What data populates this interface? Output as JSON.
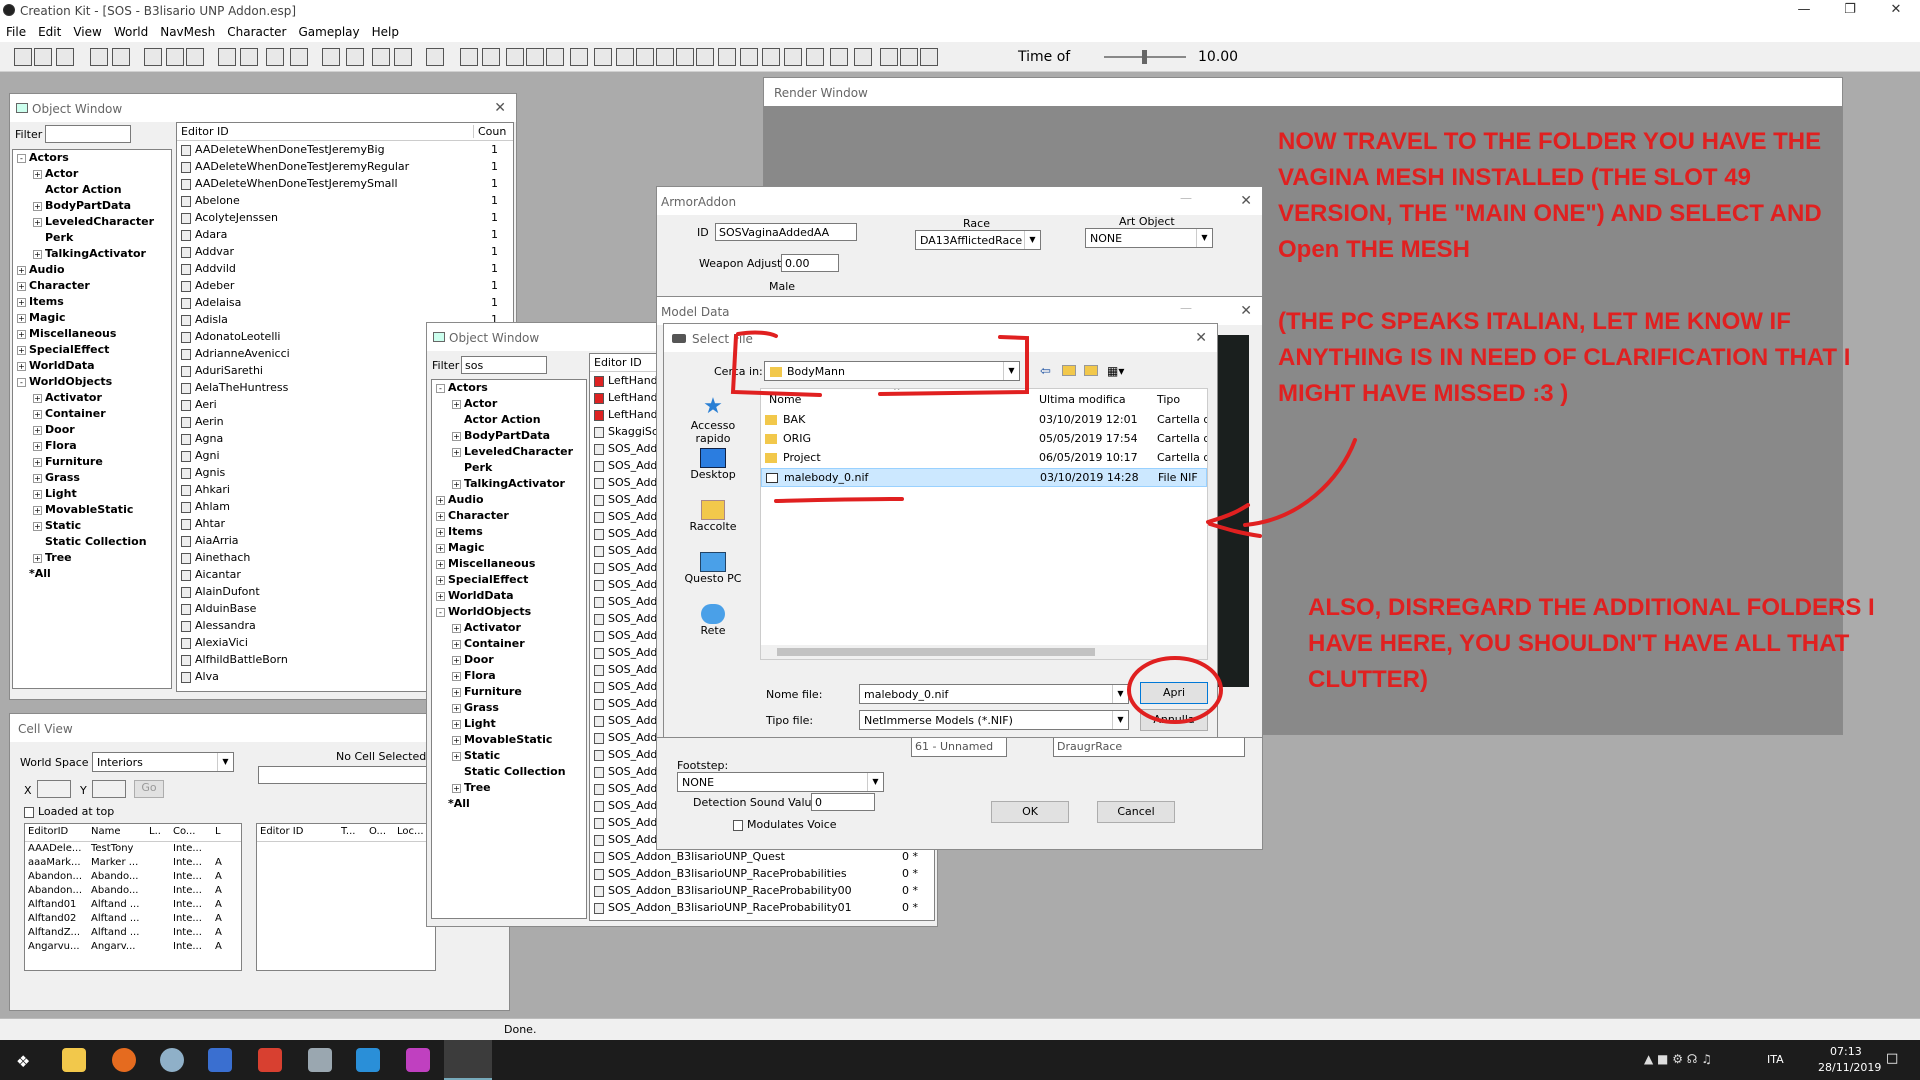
{
  "app": {
    "title": "Creation Kit - [SOS - B3lisario UNP Addon.esp]",
    "menu": [
      "File",
      "Edit",
      "View",
      "World",
      "NavMesh",
      "Character",
      "Gameplay",
      "Help"
    ],
    "time_label": "Time of",
    "time_value": "10.00",
    "status": "Done."
  },
  "object_window_1": {
    "title": "Object Window",
    "filter_label": "Filter",
    "filter_value": "",
    "columns": [
      "Editor ID",
      "Coun"
    ],
    "tree": [
      {
        "label": "Actors",
        "exp": "-",
        "indent": 0
      },
      {
        "label": "Actor",
        "exp": "+",
        "indent": 1
      },
      {
        "label": "Actor Action",
        "exp": "",
        "indent": 1
      },
      {
        "label": "BodyPartData",
        "exp": "+",
        "indent": 1
      },
      {
        "label": "LeveledCharacter",
        "exp": "+",
        "indent": 1
      },
      {
        "label": "Perk",
        "exp": "",
        "indent": 1
      },
      {
        "label": "TalkingActivator",
        "exp": "+",
        "indent": 1
      },
      {
        "label": "Audio",
        "exp": "+",
        "indent": 0
      },
      {
        "label": "Character",
        "exp": "+",
        "indent": 0
      },
      {
        "label": "Items",
        "exp": "+",
        "indent": 0
      },
      {
        "label": "Magic",
        "exp": "+",
        "indent": 0
      },
      {
        "label": "Miscellaneous",
        "exp": "+",
        "indent": 0
      },
      {
        "label": "SpecialEffect",
        "exp": "+",
        "indent": 0
      },
      {
        "label": "WorldData",
        "exp": "+",
        "indent": 0
      },
      {
        "label": "WorldObjects",
        "exp": "-",
        "indent": 0
      },
      {
        "label": "Activator",
        "exp": "+",
        "indent": 1
      },
      {
        "label": "Container",
        "exp": "+",
        "indent": 1
      },
      {
        "label": "Door",
        "exp": "+",
        "indent": 1
      },
      {
        "label": "Flora",
        "exp": "+",
        "indent": 1
      },
      {
        "label": "Furniture",
        "exp": "+",
        "indent": 1
      },
      {
        "label": "Grass",
        "exp": "+",
        "indent": 1
      },
      {
        "label": "Light",
        "exp": "+",
        "indent": 1
      },
      {
        "label": "MovableStatic",
        "exp": "+",
        "indent": 1
      },
      {
        "label": "Static",
        "exp": "+",
        "indent": 1
      },
      {
        "label": "Static Collection",
        "exp": "",
        "indent": 1
      },
      {
        "label": "Tree",
        "exp": "+",
        "indent": 1
      },
      {
        "label": "*All",
        "exp": "",
        "indent": 0
      }
    ],
    "rows": [
      [
        "AADeleteWhenDoneTestJeremyBig",
        "1"
      ],
      [
        "AADeleteWhenDoneTestJeremyRegular",
        "1"
      ],
      [
        "AADeleteWhenDoneTestJeremySmall",
        "1"
      ],
      [
        "Abelone",
        "1"
      ],
      [
        "AcolyteJenssen",
        "1"
      ],
      [
        "Adara",
        "1"
      ],
      [
        "Addvar",
        "1"
      ],
      [
        "Addvild",
        "1"
      ],
      [
        "Adeber",
        "1"
      ],
      [
        "Adelaisa",
        "1"
      ],
      [
        "Adisla",
        "1"
      ],
      [
        "AdonatoLeotelli",
        "1"
      ],
      [
        "AdrianneAvenicci",
        "1"
      ],
      [
        "AduriSarethi",
        "1"
      ],
      [
        "AelaTheHuntress",
        "1"
      ],
      [
        "Aeri",
        "1"
      ],
      [
        "Aerin",
        "1"
      ],
      [
        "Agna",
        "1"
      ],
      [
        "Agni",
        "1"
      ],
      [
        "Agnis",
        "1"
      ],
      [
        "Ahkari",
        "1"
      ],
      [
        "Ahlam",
        "1"
      ],
      [
        "Ahtar",
        "1"
      ],
      [
        "AiaArria",
        "1"
      ],
      [
        "Ainethach",
        "1"
      ],
      [
        "Aicantar",
        "1"
      ],
      [
        "AlainDufont",
        "1"
      ],
      [
        "AlduinBase",
        "1"
      ],
      [
        "Alessandra",
        "1"
      ],
      [
        "AlexiaVici",
        "1"
      ],
      [
        "AlfhildBattleBorn",
        "1"
      ],
      [
        "Alva",
        "1"
      ]
    ]
  },
  "object_window_2": {
    "title": "Object Window",
    "filter_label": "Filter",
    "filter_value": "sos",
    "column": "Editor ID",
    "tree": [
      {
        "label": "Actors",
        "exp": "-",
        "indent": 0
      },
      {
        "label": "Actor",
        "exp": "+",
        "indent": 1
      },
      {
        "label": "Actor Action",
        "exp": "",
        "indent": 1
      },
      {
        "label": "BodyPartData",
        "exp": "+",
        "indent": 1
      },
      {
        "label": "LeveledCharacter",
        "exp": "+",
        "indent": 1
      },
      {
        "label": "Perk",
        "exp": "",
        "indent": 1
      },
      {
        "label": "TalkingActivator",
        "exp": "+",
        "indent": 1
      },
      {
        "label": "Audio",
        "exp": "+",
        "indent": 0
      },
      {
        "label": "Character",
        "exp": "+",
        "indent": 0
      },
      {
        "label": "Items",
        "exp": "+",
        "indent": 0
      },
      {
        "label": "Magic",
        "exp": "+",
        "indent": 0
      },
      {
        "label": "Miscellaneous",
        "exp": "+",
        "indent": 0
      },
      {
        "label": "SpecialEffect",
        "exp": "+",
        "indent": 0
      },
      {
        "label": "WorldData",
        "exp": "+",
        "indent": 0
      },
      {
        "label": "WorldObjects",
        "exp": "-",
        "indent": 0
      },
      {
        "label": "Activator",
        "exp": "+",
        "indent": 1
      },
      {
        "label": "Container",
        "exp": "+",
        "indent": 1
      },
      {
        "label": "Door",
        "exp": "+",
        "indent": 1
      },
      {
        "label": "Flora",
        "exp": "+",
        "indent": 1
      },
      {
        "label": "Furniture",
        "exp": "+",
        "indent": 1
      },
      {
        "label": "Grass",
        "exp": "+",
        "indent": 1
      },
      {
        "label": "Light",
        "exp": "+",
        "indent": 1
      },
      {
        "label": "MovableStatic",
        "exp": "+",
        "indent": 1
      },
      {
        "label": "Static",
        "exp": "+",
        "indent": 1
      },
      {
        "label": "Static Collection",
        "exp": "",
        "indent": 1
      },
      {
        "label": "Tree",
        "exp": "+",
        "indent": 1
      },
      {
        "label": "*All",
        "exp": "",
        "indent": 0
      }
    ],
    "rows": [
      "LeftHand",
      "LeftHand",
      "LeftHand",
      "SkaggiSc",
      "SOS_Add",
      "SOS_Add",
      "SOS_Add",
      "SOS_Add",
      "SOS_Add",
      "SOS_Add",
      "SOS_Add",
      "SOS_Add",
      "SOS_Add",
      "SOS_Add",
      "SOS_Add",
      "SOS_Add",
      "SOS_Add",
      "SOS_Add",
      "SOS_Add",
      "SOS_Add",
      "SOS_Add",
      "SOS_Add",
      "SOS_Add",
      "SOS_Add",
      "SOS_Add",
      "SOS_Add",
      "SOS_Add",
      "SOS_Add"
    ],
    "bottom_rows": [
      [
        "SOS_Addon_B3lisarioUNP_Quest",
        "0 *"
      ],
      [
        "SOS_Addon_B3lisarioUNP_RaceProbabilities",
        "0 *"
      ],
      [
        "SOS_Addon_B3lisarioUNP_RaceProbability00",
        "0 *"
      ],
      [
        "SOS_Addon_B3lisarioUNP_RaceProbability01",
        "0 *"
      ]
    ]
  },
  "cell_view": {
    "title": "Cell View",
    "world_space_label": "World Space",
    "world_space_value": "Interiors",
    "no_cell": "No Cell Selected",
    "x_label": "X",
    "y_label": "Y",
    "go_label": "Go",
    "loaded_label": "Loaded at top",
    "columns_left": [
      "EditorID",
      "Name",
      "L..",
      "Co...",
      "L"
    ],
    "rows_left": [
      [
        "AAADele...",
        "TestTony",
        "",
        "Inte...",
        ""
      ],
      [
        "aaaMark...",
        "Marker ...",
        "",
        "Inte...",
        "A"
      ],
      [
        "Abandon...",
        "Abando...",
        "",
        "Inte...",
        "A"
      ],
      [
        "Abandon...",
        "Abando...",
        "",
        "Inte...",
        "A"
      ],
      [
        "Alftand01",
        "Alftand ...",
        "",
        "Inte...",
        "A"
      ],
      [
        "Alftand02",
        "Alftand ...",
        "",
        "Inte...",
        "A"
      ],
      [
        "AlftandZ...",
        "Alftand ...",
        "",
        "Inte...",
        "A"
      ],
      [
        "Angarvu...",
        "Angarv...",
        "",
        "Inte...",
        "A"
      ]
    ],
    "columns_right": [
      "Editor ID",
      "T...",
      "O...",
      "Loc..."
    ]
  },
  "render_window": {
    "title": "Render Window"
  },
  "armor_addon": {
    "title": "ArmorAddon",
    "id_label": "ID",
    "id_value": "SOSVaginaAddedAA",
    "race_label": "Race",
    "race_value": "DA13AfflictedRace",
    "art_label": "Art Object",
    "art_value": "NONE",
    "weapon_adjust_label": "Weapon Adjust",
    "weapon_adjust_value": "0.00",
    "male_label": "Male",
    "footstep_label": "Footstep:",
    "footstep_value": "NONE",
    "detection_label": "Detection Sound Value",
    "detection_value": "0",
    "modulates_label": "Modulates Voice",
    "unnamed_text": "61 - Unnamed",
    "draugr_text": "DraugrRace",
    "ok": "OK",
    "cancel": "Cancel"
  },
  "model_data": {
    "title": "Model Data"
  },
  "select_file": {
    "title": "Select File",
    "look_in_label": "Cerca in:",
    "look_in_value": "BodyMann",
    "places": [
      "Accesso rapido",
      "Desktop",
      "Raccolte",
      "Questo PC",
      "Rete"
    ],
    "columns": [
      "Nome",
      "Ultima modifica",
      "Tipo"
    ],
    "files": [
      {
        "name": "BAK",
        "date": "03/10/2019 12:01",
        "type": "Cartella di",
        "kind": "folder"
      },
      {
        "name": "ORIG",
        "date": "05/05/2019 17:54",
        "type": "Cartella di",
        "kind": "folder"
      },
      {
        "name": "Project",
        "date": "06/05/2019 10:17",
        "type": "Cartella di",
        "kind": "folder"
      },
      {
        "name": "malebody_0.nif",
        "date": "03/10/2019 14:28",
        "type": "File NIF",
        "kind": "file"
      }
    ],
    "filename_label": "Nome file:",
    "filename_value": "malebody_0.nif",
    "filetype_label": "Tipo file:",
    "filetype_value": "NetImmerse Models (*.NIF)",
    "open": "Apri",
    "cancel": "Annulla"
  },
  "annotations": {
    "text1_lines": [
      "NOW TRAVEL TO THE FOLDER YOU HAVE THE",
      "VAGINA MESH INSTALLED (THE SLOT 49",
      "VERSION, THE \"MAIN ONE\") AND SELECT AND",
      "Open  THE MESH"
    ],
    "text2_lines": [
      "(THE PC SPEAKS ITALIAN, LET ME KNOW IF",
      "ANYTHING IS IN NEED OF CLARIFICATION THAT I",
      "MIGHT HAVE MISSED :3 )"
    ],
    "text3_lines": [
      "ALSO, DISREGARD THE ADDITIONAL FOLDERS I",
      "HAVE HERE, YOU SHOULDN'T HAVE ALL THAT",
      "CLUTTER)"
    ],
    "color": "#e02020"
  },
  "taskbar": {
    "lang": "ITA",
    "time": "07:13",
    "date": "28/11/2019"
  }
}
